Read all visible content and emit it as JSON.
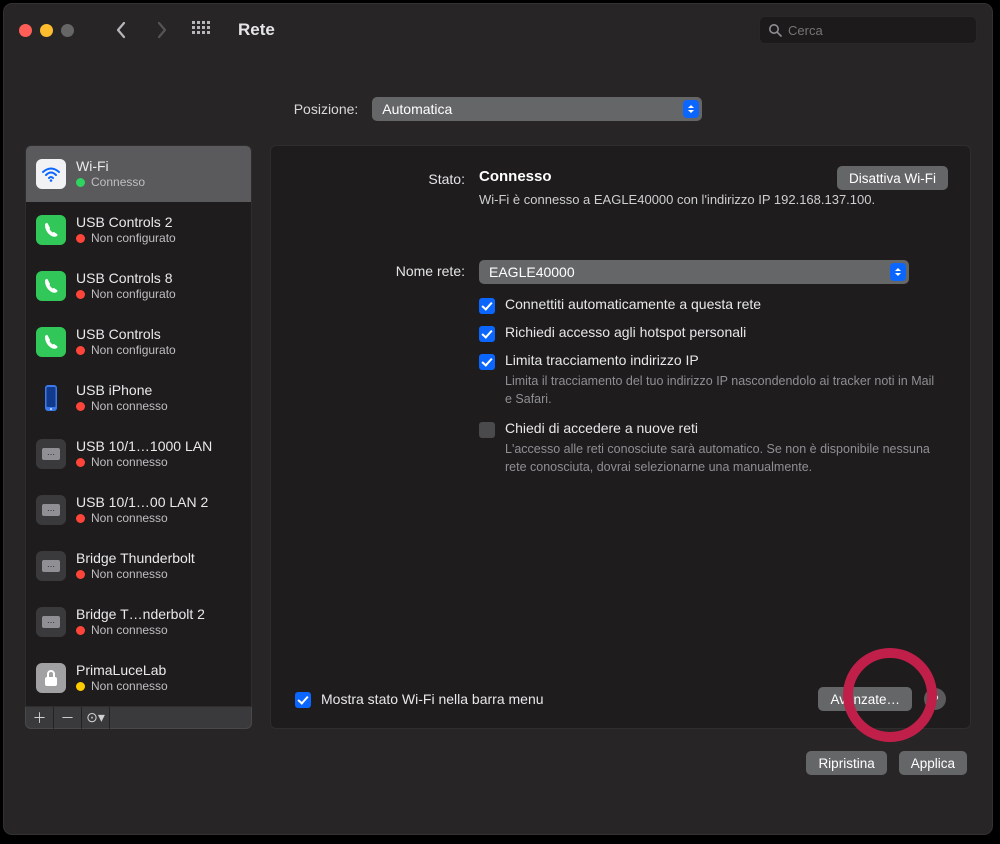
{
  "header": {
    "title": "Rete",
    "search_placeholder": "Cerca"
  },
  "position": {
    "label": "Posizione:",
    "value": "Automatica"
  },
  "sidebar": {
    "items": [
      {
        "name": "Wi-Fi",
        "status": "Connesso",
        "color": "green",
        "icon": "wifi"
      },
      {
        "name": "USB Controls 2",
        "status": "Non configurato",
        "color": "red",
        "icon": "phone"
      },
      {
        "name": "USB Controls 8",
        "status": "Non configurato",
        "color": "red",
        "icon": "phone"
      },
      {
        "name": "USB Controls",
        "status": "Non configurato",
        "color": "red",
        "icon": "phone"
      },
      {
        "name": "USB iPhone",
        "status": "Non connesso",
        "color": "red",
        "icon": "device"
      },
      {
        "name": "USB 10/1…1000 LAN",
        "status": "Non connesso",
        "color": "red",
        "icon": "lan"
      },
      {
        "name": "USB 10/1…00 LAN 2",
        "status": "Non connesso",
        "color": "red",
        "icon": "lan"
      },
      {
        "name": "Bridge Thunderbolt",
        "status": "Non connesso",
        "color": "red",
        "icon": "lan"
      },
      {
        "name": "Bridge T…nderbolt 2",
        "status": "Non connesso",
        "color": "red",
        "icon": "lan"
      },
      {
        "name": "PrimaLuceLab",
        "status": "Non connesso",
        "color": "yellow",
        "icon": "lock"
      }
    ]
  },
  "pane": {
    "status_label": "Stato:",
    "status_value": "Connesso",
    "disable_button": "Disattiva Wi-Fi",
    "status_desc": "Wi-Fi è connesso a EAGLE40000 con l'indirizzo IP 192.168.137.100.",
    "network_label": "Nome rete:",
    "network_value": "EAGLE40000",
    "chk_auto": "Connettiti automaticamente a questa rete",
    "chk_hot": "Richiedi accesso agli hotspot personali",
    "chk_limit": "Limita tracciamento indirizzo IP",
    "limit_note": "Limita il tracciamento del tuo indirizzo IP nascondendolo ai tracker noti in Mail e Safari.",
    "chk_ask": "Chiedi di accedere a nuove reti",
    "ask_note": "L'accesso alle reti conosciute sarà automatico. Se non è disponibile nessuna rete conosciuta, dovrai selezionarne una manualmente.",
    "show_menubar": "Mostra stato Wi-Fi nella barra menu",
    "advanced_button": "Avanzate…",
    "help": "?"
  },
  "footer": {
    "revert": "Ripristina",
    "apply": "Applica"
  }
}
